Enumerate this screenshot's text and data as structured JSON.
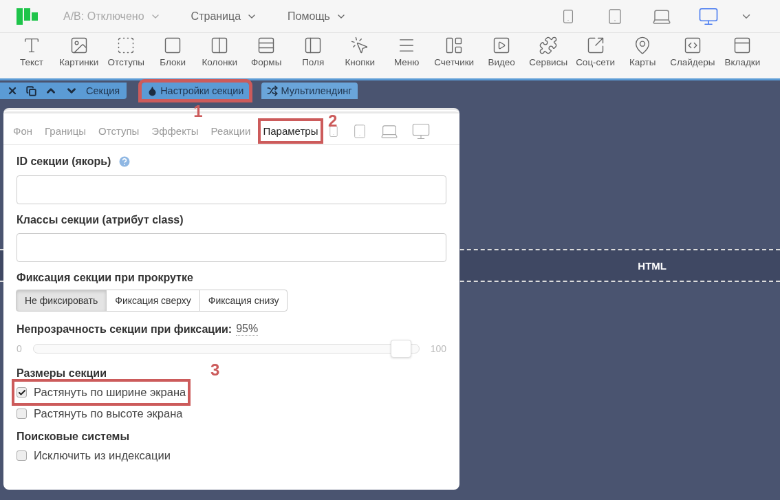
{
  "topbar": {
    "ab_menu": {
      "label": "A/B: Отключено",
      "disabled": true
    },
    "menus": [
      {
        "label": "Страница"
      },
      {
        "label": "Помощь"
      }
    ],
    "devices": [
      {
        "kind": "phone",
        "selected": false
      },
      {
        "kind": "tablet",
        "selected": false
      },
      {
        "kind": "laptop",
        "selected": false
      },
      {
        "kind": "desktop",
        "selected": true
      }
    ]
  },
  "tools": [
    {
      "kind": "text",
      "label": "Текст"
    },
    {
      "kind": "image",
      "label": "Картинки"
    },
    {
      "kind": "spacing",
      "label": "Отступы"
    },
    {
      "kind": "block",
      "label": "Блоки"
    },
    {
      "kind": "columns",
      "label": "Колонки"
    },
    {
      "kind": "forms",
      "label": "Формы"
    },
    {
      "kind": "field",
      "label": "Поля"
    },
    {
      "kind": "button",
      "label": "Кнопки"
    },
    {
      "kind": "menu",
      "label": "Меню"
    },
    {
      "kind": "counter",
      "label": "Счетчики"
    },
    {
      "kind": "video",
      "label": "Видео"
    },
    {
      "kind": "services",
      "label": "Сервисы"
    },
    {
      "kind": "social",
      "label": "Соц-сети"
    },
    {
      "kind": "map",
      "label": "Карты"
    },
    {
      "kind": "slider",
      "label": "Слайдеры"
    },
    {
      "kind": "tabs",
      "label": "Вкладки"
    }
  ],
  "section_bar": {
    "label": "Секция",
    "tabs": [
      {
        "kind": "settings",
        "label": "Настройки секции",
        "selected": true,
        "annotation": "1"
      },
      {
        "kind": "multi",
        "label": "Мультилендинг",
        "selected": false
      }
    ]
  },
  "panel": {
    "tabs": [
      {
        "label": "Фон",
        "selected": false
      },
      {
        "label": "Границы",
        "selected": false
      },
      {
        "label": "Отступы",
        "selected": false
      },
      {
        "label": "Эффекты",
        "selected": false
      },
      {
        "label": "Реакции",
        "selected": false
      },
      {
        "label": "Параметры",
        "selected": true,
        "annotation": "2"
      }
    ],
    "devices": [
      {
        "kind": "phone"
      },
      {
        "kind": "tablet"
      },
      {
        "kind": "laptop"
      },
      {
        "kind": "desktop"
      }
    ],
    "id_field": {
      "label": "ID секции (якорь)"
    },
    "class_field": {
      "label": "Классы секции (атрибут class)"
    },
    "fixation": {
      "label": "Фиксация секции при прокрутке",
      "options": [
        {
          "label": "Не фиксировать",
          "selected": true
        },
        {
          "label": "Фиксация сверху",
          "selected": false
        },
        {
          "label": "Фиксация снизу",
          "selected": false
        }
      ]
    },
    "opacity": {
      "label": "Непрозрачность секции при фиксации:",
      "reading": "95%",
      "min": "0",
      "max": "100",
      "level": 0.95
    },
    "groups": [
      {
        "title": "Размеры секции",
        "options": [
          {
            "label": "Растянуть по ширине экрана",
            "checked": true,
            "annotation": "3"
          },
          {
            "label": "Растянуть по высоте экрана",
            "checked": false
          }
        ]
      },
      {
        "title": "Поисковые системы",
        "options": [
          {
            "label": "Исключить из индексации",
            "checked": false
          }
        ]
      }
    ]
  },
  "canvas": {
    "block_label": "HTML"
  }
}
